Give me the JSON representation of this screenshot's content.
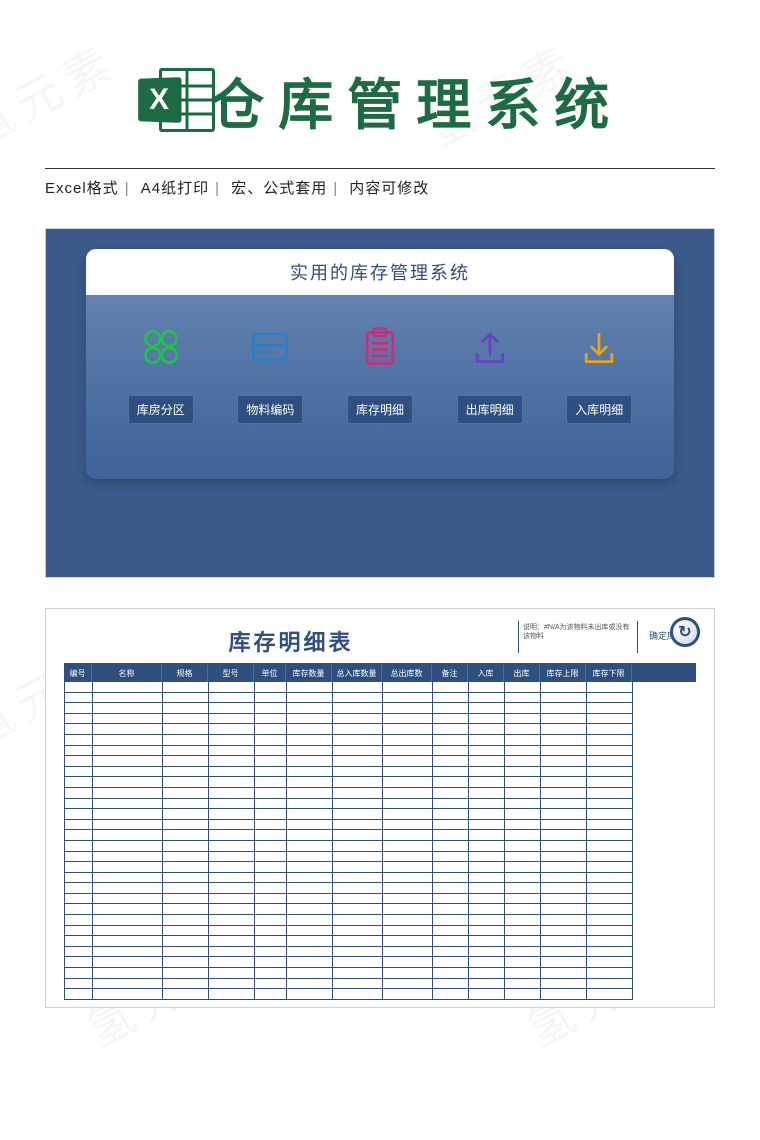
{
  "header": {
    "title": "仓库管理系统",
    "icon_letter": "X",
    "subinfo": [
      "Excel格式",
      "A4纸打印",
      "宏、公式套用",
      "内容可修改"
    ]
  },
  "panel": {
    "title": "实用的库存管理系统",
    "items": [
      {
        "label": "库房分区",
        "icon": "clover-icon",
        "color": "#1fc24a"
      },
      {
        "label": "物料编码",
        "icon": "card-icon",
        "color": "#2a7ec9"
      },
      {
        "label": "库存明细",
        "icon": "clipboard-icon",
        "color": "#d12a7d"
      },
      {
        "label": "出库明细",
        "icon": "upload-icon",
        "color": "#6a3fc9"
      },
      {
        "label": "入库明细",
        "icon": "download-icon",
        "color": "#e8a516"
      }
    ]
  },
  "sheet": {
    "title": "库存明细表",
    "note": "说明：#N/A为该物料未出库或没有该物料",
    "button": "确定库存",
    "columns": [
      "编号",
      "名称",
      "规格",
      "型号",
      "单位",
      "库存数量",
      "总入库数量",
      "总出库数",
      "备注",
      "入库",
      "出库",
      "库存上限",
      "库存下限"
    ],
    "row_count": 30
  },
  "watermark": "氢元素"
}
